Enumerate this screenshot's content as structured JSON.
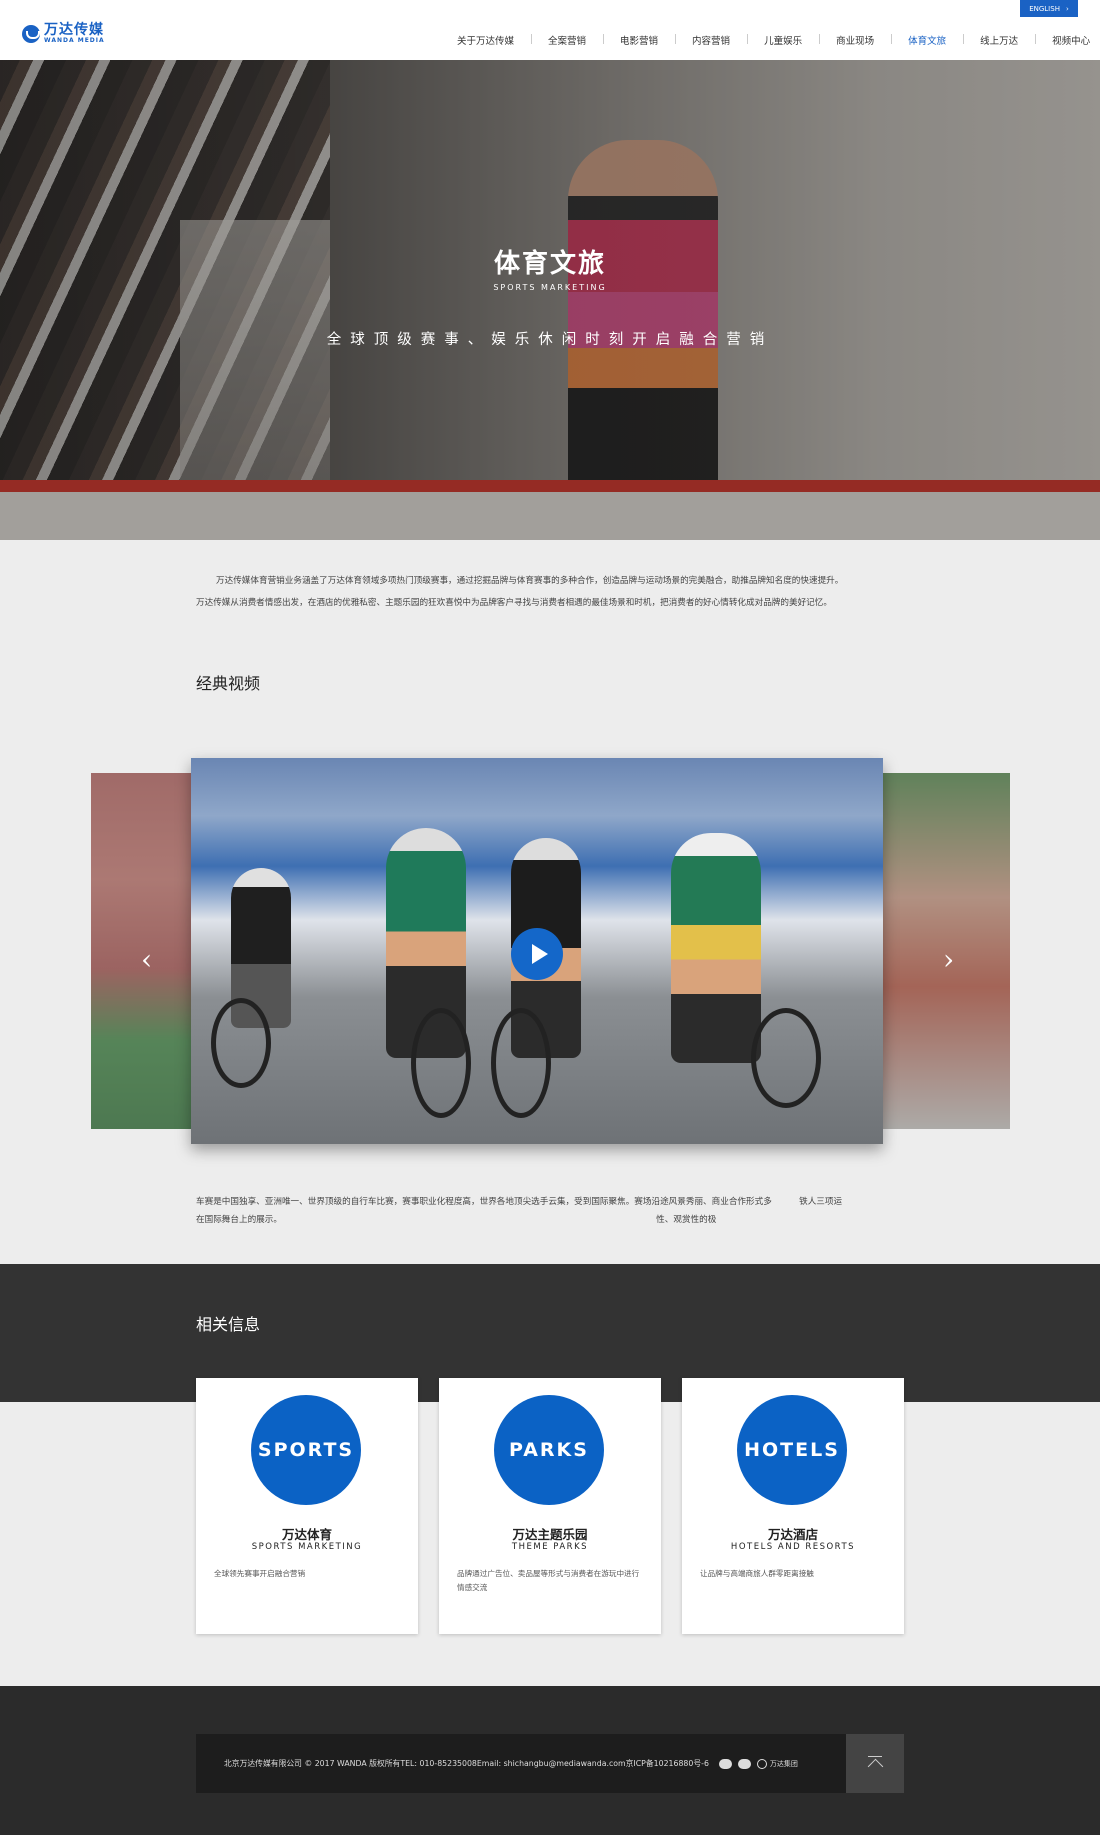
{
  "header": {
    "logo_cn": "万达传媒",
    "logo_en": "WANDA MEDIA",
    "lang_button": "ENGLISH",
    "nav": [
      "关于万达传媒",
      "全案营销",
      "电影营销",
      "内容营销",
      "儿童娱乐",
      "商业现场",
      "体育文旅",
      "线上万达",
      "视频中心"
    ],
    "active_nav": "体育文旅"
  },
  "hero": {
    "title": "体育文旅",
    "subtitle": "SPORTS MARKETING",
    "slogan": "全球顶级赛事、娱乐休闲时刻开启融合营销"
  },
  "intro": {
    "p1": "万达传媒体育营销业务涵盖了万达体育领域多项热门顶级赛事，通过挖掘品牌与体育赛事的多种合作，创造品牌与运动场景的完美融合，助推品牌知名度的快速提升。",
    "p2": "万达传媒从消费者情感出发，在酒店的优雅私密、主题乐园的狂欢喜悦中为品牌客户寻找与消费者相遇的最佳场景和时机，把消费者的好心情转化成对品牌的美好记忆。"
  },
  "video": {
    "section_title": "经典视频",
    "prev_arrow": "‹",
    "next_arrow": "›",
    "desc_line1": "车赛是中国独享、亚洲唯一、世界顶级的自行车比赛，赛事职业化程度高，世界各地顶尖选手云集，受到国际聚焦。赛场沿途风景秀丽、商业合作形式多          铁人三项运",
    "desc_line2": "在国际舞台上的展示。                                                                                                                                         性、观赏性的极"
  },
  "related": {
    "title": "相关信息",
    "cards": [
      {
        "badge": "SPORTS",
        "title_cn": "万达体育",
        "title_en": "SPORTS MARKETING",
        "desc": "全球领先赛事开启融合营销"
      },
      {
        "badge": "PARKS",
        "title_cn": "万达主题乐园",
        "title_en": "THEME PARKS",
        "desc": "品牌通过广告位、卖品屋等形式与消费者在游玩中进行情感交流"
      },
      {
        "badge": "HOTELS",
        "title_cn": "万达酒店",
        "title_en": "HOTELS AND RESORTS",
        "desc": "让品牌与高端商旅人群零距离接触"
      }
    ]
  },
  "footer": {
    "copyright": "北京万达传媒有限公司 © 2017 WANDA 版权所有TEL: 010-85235008Email: shichangbu@mediawanda.com京ICP备10216880号-6",
    "group_logo": "万达集团"
  },
  "colors": {
    "brand_blue": "#1a62c4",
    "dark_band": "#333333",
    "footer_bg": "#2b2b2b"
  }
}
